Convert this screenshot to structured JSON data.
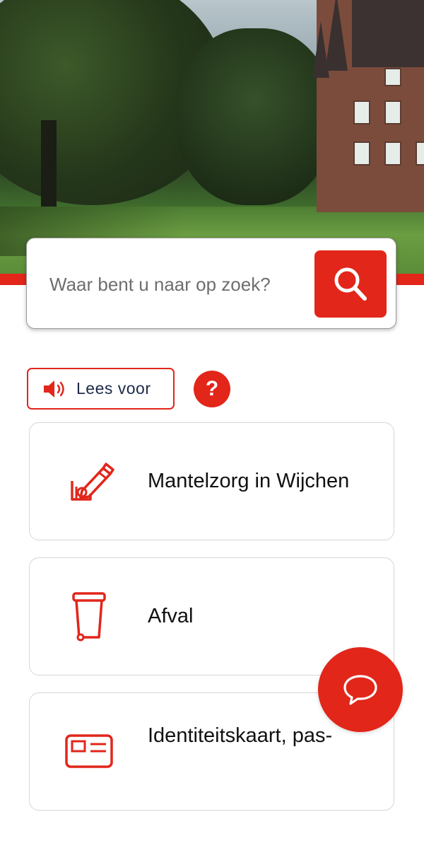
{
  "hero": {
    "image_name": "castle-park-photo"
  },
  "search": {
    "placeholder": "Waar bent u naar op zoek?",
    "button_icon": "search-icon"
  },
  "read_aloud": {
    "label": "Lees voor",
    "icon": "speaker-icon"
  },
  "help": {
    "label": "?"
  },
  "topics": [
    {
      "label": "Mantelzorg in Wijchen",
      "icon": "care-pencil-icon"
    },
    {
      "label": "Afval",
      "icon": "waste-bin-icon"
    },
    {
      "label": "Identiteitskaart, pas-",
      "icon": "id-card-icon"
    }
  ],
  "chat": {
    "icon": "chat-bubble-icon"
  },
  "colors": {
    "accent": "#e2261a",
    "text_dark": "#1c2a4a",
    "card_border": "#d6d6d6"
  }
}
